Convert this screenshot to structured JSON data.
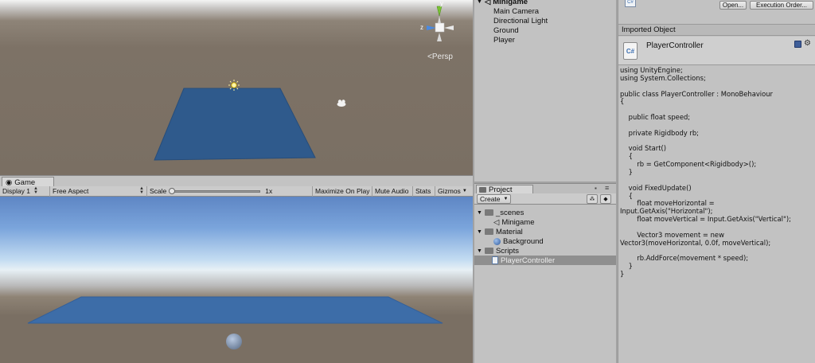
{
  "scene": {
    "persp_label": "Persp",
    "gizmo_axes": {
      "y": "y",
      "z": "z"
    }
  },
  "game": {
    "tab_label": "Game",
    "toolbar": {
      "display": "Display 1",
      "aspect": "Free Aspect",
      "scale_label": "Scale",
      "scale_value": "1x",
      "maximize_on_play": "Maximize On Play",
      "mute_audio": "Mute Audio",
      "stats": "Stats",
      "gizmos": "Gizmos"
    }
  },
  "hierarchy": {
    "scene_name": "Minigame",
    "items": [
      "Main Camera",
      "Directional Light",
      "Ground",
      "Player"
    ]
  },
  "project": {
    "tab_label": "Project",
    "create_label": "Create",
    "folders": [
      {
        "name": "_scenes",
        "children": [
          "Minigame"
        ]
      },
      {
        "name": "Material",
        "children": [
          "Background"
        ]
      },
      {
        "name": "Scripts",
        "children": [
          "PlayerController"
        ]
      }
    ],
    "selected": "PlayerController"
  },
  "inspector": {
    "cs_badge": "C#",
    "open_button": "Open...",
    "execution_order_button": "Execution Order...",
    "header": "Imported Object",
    "asset_name": "PlayerController",
    "code_lines": [
      "using UnityEngine;",
      "using System.Collections;",
      "",
      "public class PlayerController : MonoBehaviour",
      "{",
      "",
      "    public float speed;",
      "",
      "    private Rigidbody rb;",
      "",
      "    void Start()",
      "    {",
      "        rb = GetComponent<Rigidbody>();",
      "    }",
      "",
      "    void FixedUpdate()",
      "    {",
      "        float moveHorizontal =",
      "Input.GetAxis(\"Horizontal\");",
      "        float moveVertical = Input.GetAxis(\"Vertical\");",
      "",
      "        Vector3 movement = new",
      "Vector3(moveHorizontal, 0.0f, moveVertical);",
      "",
      "        rb.AddForce(movement * speed);",
      "    }",
      "}"
    ]
  },
  "colors": {
    "plane": "#2f5a8c",
    "selection": "#8f8f8f",
    "panel": "#c2c2c2"
  }
}
